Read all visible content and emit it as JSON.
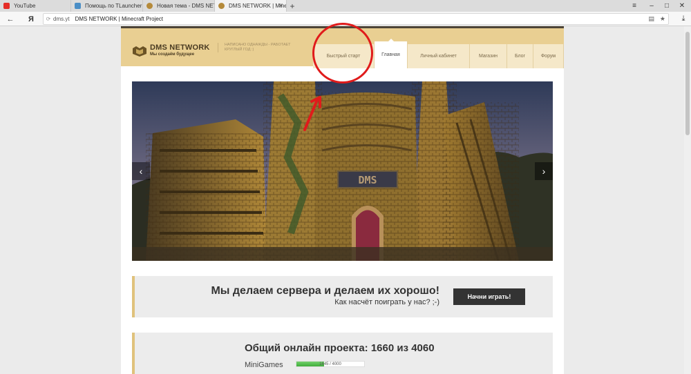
{
  "browser": {
    "tabs": [
      {
        "title": "YouTube",
        "favicon_color": "#e52d27",
        "active": false
      },
      {
        "title": "Помощь по TLauncher (Fail",
        "favicon_color": "#4a8ec6",
        "active": false
      },
      {
        "title": "Новая тема - DMS NETWOR",
        "favicon_color": "#b58a3a",
        "active": false
      },
      {
        "title": "DMS NETWORK | Minecra",
        "favicon_color": "#b58a3a",
        "active": true
      }
    ],
    "new_tab_symbol": "+",
    "back_symbol": "←",
    "yandex_symbol": "Я",
    "address": {
      "domain": "dms.yt",
      "page_title": "DMS NETWORK | Minecraft Project"
    }
  },
  "site": {
    "logo": {
      "title": "DMS NETWORK",
      "subtitle": "Мы создаём будущее"
    },
    "slogan": "НАПИСАНО ОДНАЖДЫ - РАБОТАЕТ КРУГЛЫЙ ГОД :)",
    "menu": [
      {
        "label": "Быстрый старт",
        "active": false
      },
      {
        "label": "Главная",
        "active": true
      },
      {
        "label": "Личный кабинет",
        "active": false
      },
      {
        "label": "Магазин",
        "active": false
      },
      {
        "label": "Блог",
        "active": false
      },
      {
        "label": "Форум",
        "active": false
      }
    ],
    "slider": {
      "sign_text": "DMS",
      "prev_symbol": "‹",
      "next_symbol": "›"
    },
    "cta": {
      "title": "Мы делаем сервера и делаем их хорошо!",
      "subtitle": "Как насчёт поиграть у нас? ;-)",
      "button_label": "Начни играть!"
    },
    "online": {
      "title": "Общий онлайн проекта: 1660 из 4060",
      "servers": [
        {
          "name": "MiniGames",
          "value_label": "1645 / 4000",
          "fraction": 0.41
        }
      ]
    }
  },
  "colors": {
    "header_bg": "#e9cf92",
    "annotation": "#e01b1b",
    "button_bg": "#333333"
  }
}
